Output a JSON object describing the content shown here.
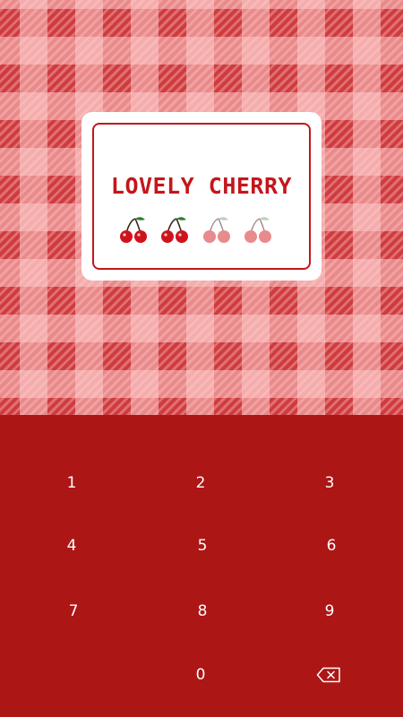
{
  "card": {
    "title": "LOVELY CHERRY",
    "pin_total": 4,
    "pin_entered": 2,
    "indicator_icon": "cherry-icon"
  },
  "keypad": {
    "keys": [
      "1",
      "2",
      "3",
      "4",
      "5",
      "6",
      "7",
      "8",
      "9",
      "0"
    ],
    "backspace_icon": "backspace-icon"
  },
  "colors": {
    "background_red": "#cf3b3e",
    "keypad_red": "#ac1615",
    "accent_red": "#c4161c",
    "cherry_filled": "#d0131b",
    "cherry_empty": "#e98a8d",
    "stem_filled": "#2e7d32",
    "stem_empty": "#b9d3bd"
  }
}
